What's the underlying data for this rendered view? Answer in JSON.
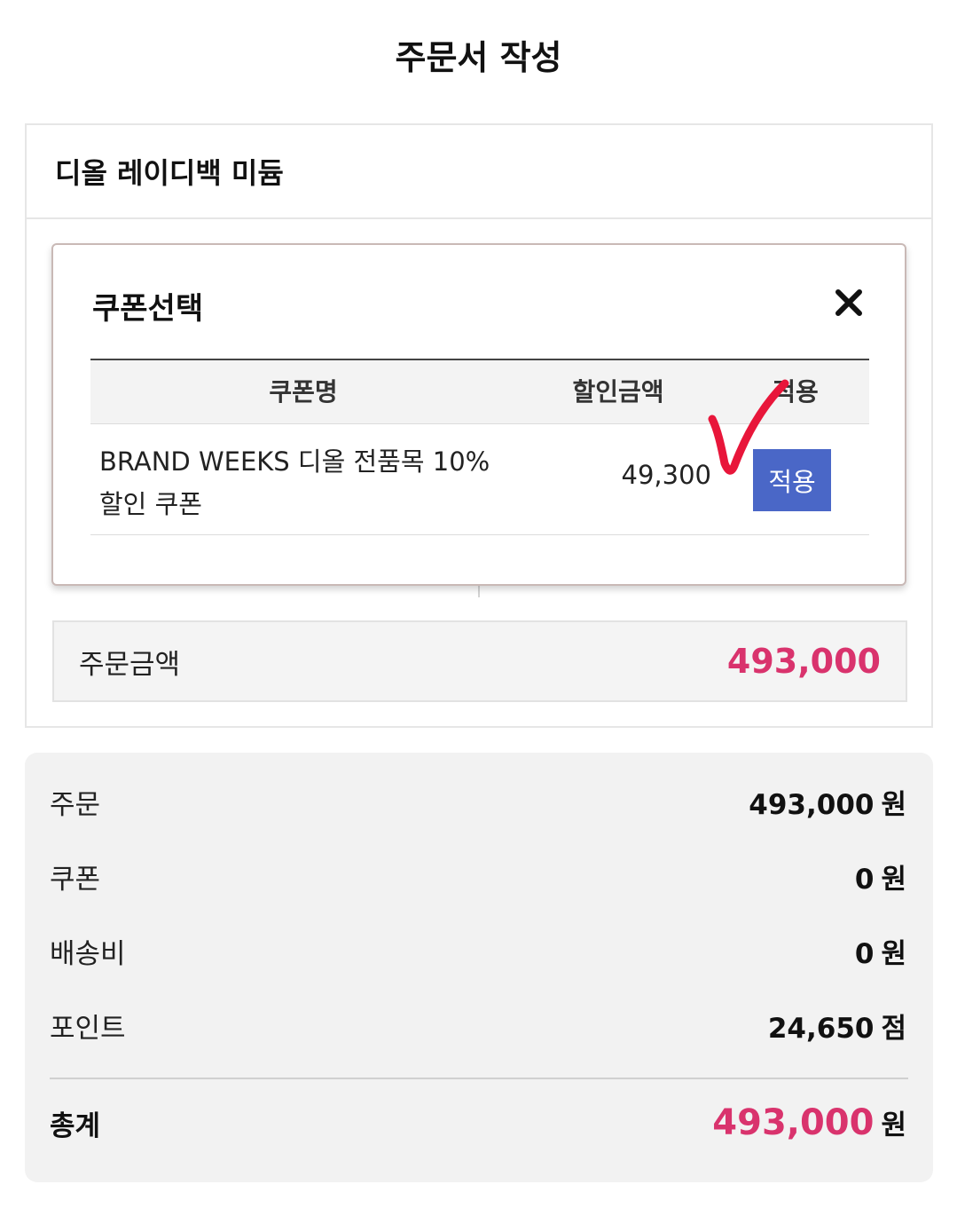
{
  "page": {
    "title": "주문서 작성"
  },
  "product": {
    "name": "디올 레이디백 미듐"
  },
  "order_amount": {
    "label": "주문금액",
    "value": "493,000",
    "accent_color": "#d9336d"
  },
  "coupon_modal": {
    "title": "쿠폰선택",
    "close_icon": "close-icon",
    "columns": {
      "name": "쿠폰명",
      "discount": "할인금액",
      "apply": "적용"
    },
    "coupons": [
      {
        "name_line1": "BRAND WEEKS 디올 전품목 10%",
        "name_line2": "할인 쿠폰",
        "discount": "49,300",
        "apply_label": "적용"
      }
    ],
    "button_color": "#4a67c7",
    "annotation_icon": "red-checkmark-icon"
  },
  "summary": {
    "order": {
      "label": "주문",
      "value": "493,000",
      "unit": "원"
    },
    "coupon": {
      "label": "쿠폰",
      "value": "0",
      "unit": "원"
    },
    "shipping": {
      "label": "배송비",
      "value": "0",
      "unit": "원"
    },
    "points": {
      "label": "포인트",
      "value": "24,650",
      "unit": "점"
    },
    "total": {
      "label": "총계",
      "value": "493,000",
      "unit": "원"
    }
  }
}
